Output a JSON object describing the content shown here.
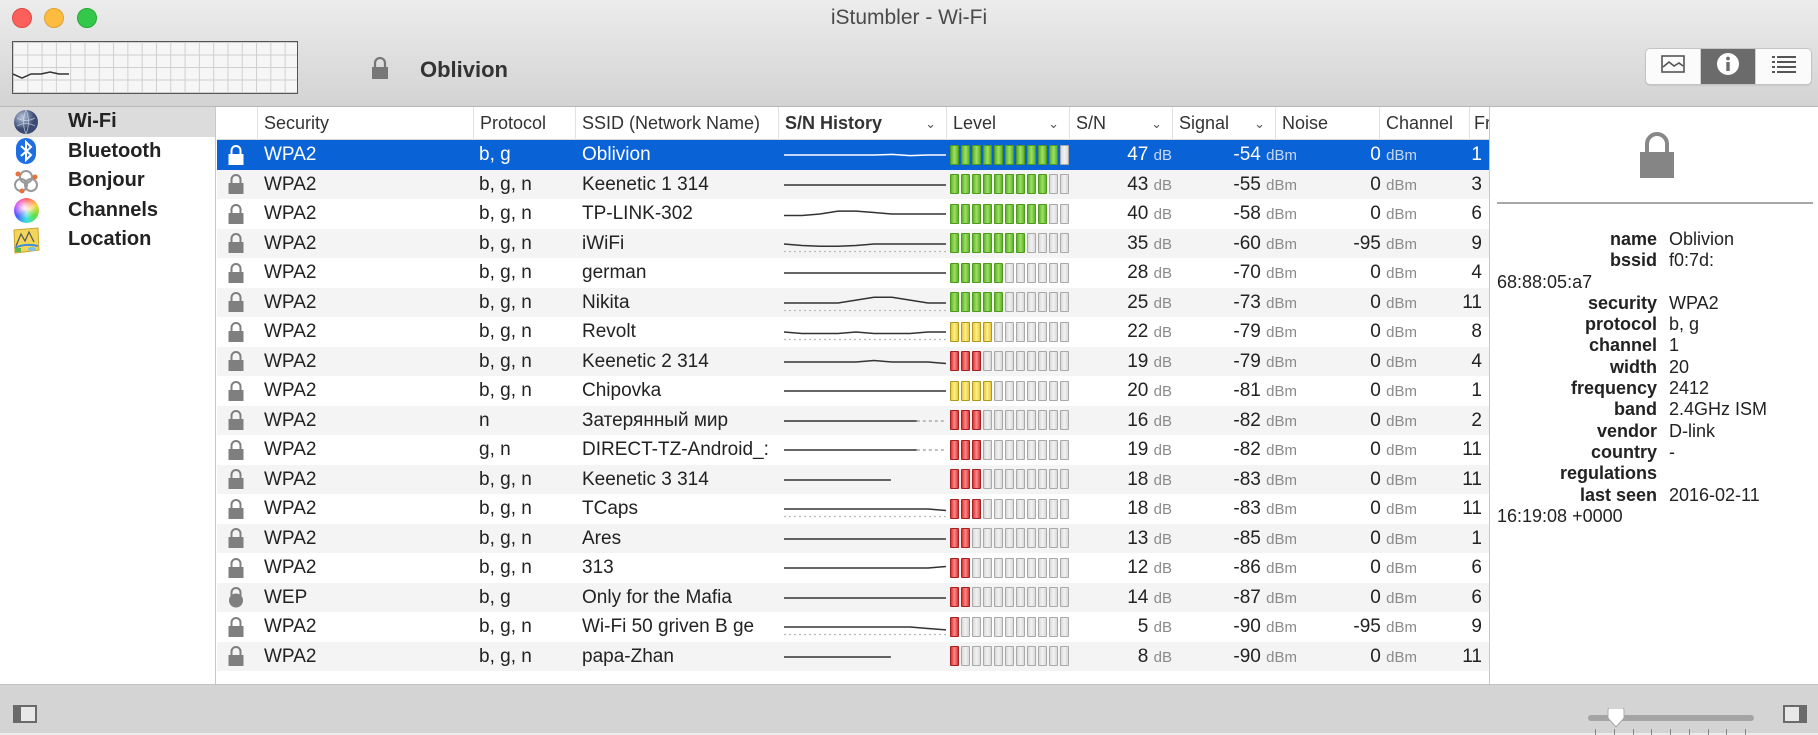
{
  "window": {
    "title": "iStumbler - Wi-Fi"
  },
  "header": {
    "selected_network": "Oblivion",
    "view_modes": [
      {
        "name": "graph-view",
        "icon": "chart-icon",
        "active": false
      },
      {
        "name": "info-view",
        "icon": "info-icon",
        "active": true
      },
      {
        "name": "list-view",
        "icon": "list-icon",
        "active": false
      }
    ]
  },
  "sidebar": {
    "items": [
      {
        "label": "Wi-Fi",
        "icon": "globe-icon",
        "selected": true
      },
      {
        "label": "Bluetooth",
        "icon": "bluetooth-icon",
        "selected": false
      },
      {
        "label": "Bonjour",
        "icon": "bonjour-icon",
        "selected": false
      },
      {
        "label": "Channels",
        "icon": "color-wheel-icon",
        "selected": false
      },
      {
        "label": "Location",
        "icon": "map-icon",
        "selected": false
      }
    ]
  },
  "table": {
    "columns": [
      {
        "key": "lock",
        "label": ""
      },
      {
        "key": "security",
        "label": "Security"
      },
      {
        "key": "protocol",
        "label": "Protocol"
      },
      {
        "key": "ssid",
        "label": "SSID (Network Name)"
      },
      {
        "key": "history",
        "label": "S/N History",
        "sortable": true
      },
      {
        "key": "level",
        "label": "Level",
        "sortable": true
      },
      {
        "key": "sn",
        "label": "S/N",
        "sortable": true
      },
      {
        "key": "signal",
        "label": "Signal",
        "sortable": true
      },
      {
        "key": "noise",
        "label": "Noise"
      },
      {
        "key": "channel",
        "label": "Channel"
      },
      {
        "key": "frequency",
        "label": "Fr"
      }
    ],
    "level_max_bars": 11,
    "units": {
      "sn": "dB",
      "signal": "dBm",
      "noise": "dBm"
    },
    "rows": [
      {
        "security": "WPA2",
        "protocol": "b, g",
        "ssid": "Oblivion",
        "level": 10,
        "level_color": "green",
        "sn": "47",
        "signal": "-54",
        "noise": "0",
        "channel": "1",
        "selected": true,
        "lock": "padlock",
        "history": [
          0.5,
          0.5,
          0.5,
          0.5,
          0.5,
          0.5,
          0.52,
          0.48,
          0.5,
          0.5
        ]
      },
      {
        "security": "WPA2",
        "protocol": "b, g, n",
        "ssid": "Keenetic  1 314",
        "level": 9,
        "level_color": "green",
        "sn": "43",
        "signal": "-55",
        "noise": "0",
        "channel": "3",
        "lock": "padlock",
        "history": [
          0.5,
          0.5,
          0.5,
          0.5,
          0.5,
          0.5,
          0.5,
          0.5,
          0.5,
          0.5
        ]
      },
      {
        "security": "WPA2",
        "protocol": "b, g, n",
        "ssid": "TP-LINK-302",
        "level": 9,
        "level_color": "green",
        "sn": "40",
        "signal": "-58",
        "noise": "0",
        "channel": "6",
        "lock": "padlock",
        "history": [
          0.45,
          0.45,
          0.5,
          0.6,
          0.6,
          0.55,
          0.5,
          0.5,
          0.5,
          0.5
        ]
      },
      {
        "security": "WPA2",
        "protocol": "b, g, n",
        "ssid": "iWiFi",
        "level": 7,
        "level_color": "green",
        "sn": "35",
        "signal": "-60",
        "noise": "-95",
        "channel": "9",
        "lock": "padlock",
        "history": [
          0.5,
          0.45,
          0.42,
          0.42,
          0.45,
          0.5,
          0.5,
          0.5,
          0.5,
          0.5
        ],
        "noise_history": true
      },
      {
        "security": "WPA2",
        "protocol": "b, g, n",
        "ssid": "german",
        "level": 5,
        "level_color": "green",
        "sn": "28",
        "signal": "-70",
        "noise": "0",
        "channel": "4",
        "lock": "padlock",
        "history": [
          0.5,
          0.5,
          0.5,
          0.5,
          0.5,
          0.5,
          0.5,
          0.5,
          0.5,
          0.5
        ]
      },
      {
        "security": "WPA2",
        "protocol": "b, g, n",
        "ssid": "Nikita",
        "level": 5,
        "level_color": "green",
        "sn": "25",
        "signal": "-73",
        "noise": "0",
        "channel": "11",
        "lock": "padlock",
        "history": [
          0.5,
          0.5,
          0.5,
          0.5,
          0.6,
          0.7,
          0.7,
          0.6,
          0.5,
          0.5
        ],
        "noise_history": true
      },
      {
        "security": "WPA2",
        "protocol": "b, g, n",
        "ssid": "Revolt",
        "level": 4,
        "level_color": "yellow",
        "sn": "22",
        "signal": "-79",
        "noise": "0",
        "channel": "8",
        "lock": "padlock",
        "history": [
          0.5,
          0.45,
          0.45,
          0.45,
          0.5,
          0.45,
          0.45,
          0.45,
          0.5,
          0.5
        ],
        "noise_history": true
      },
      {
        "security": "WPA2",
        "protocol": "b, g, n",
        "ssid": "Keenetic 2 314",
        "level": 3,
        "level_color": "red",
        "sn": "19",
        "signal": "-79",
        "noise": "0",
        "channel": "4",
        "lock": "padlock",
        "history": [
          0.5,
          0.5,
          0.5,
          0.5,
          0.5,
          0.55,
          0.5,
          0.5,
          0.5,
          0.45
        ]
      },
      {
        "security": "WPA2",
        "protocol": "b, g, n",
        "ssid": "Chipovka",
        "level": 4,
        "level_color": "yellow",
        "sn": "20",
        "signal": "-81",
        "noise": "0",
        "channel": "1",
        "lock": "padlock",
        "history": [
          0.5,
          0.5,
          0.5,
          0.5,
          0.5,
          0.5,
          0.5,
          0.5,
          0.5,
          0.5
        ]
      },
      {
        "security": "WPA2",
        "protocol": "n",
        "ssid": "Затерянный мир",
        "level": 3,
        "level_color": "red",
        "sn": "16",
        "signal": "-82",
        "noise": "0",
        "channel": "2",
        "lock": "padlock",
        "history": [
          0.5,
          0.5,
          0.5,
          0.5,
          0.5,
          0.5,
          0.5,
          0.5
        ],
        "history_gap": true
      },
      {
        "security": "WPA2",
        "protocol": "g, n",
        "ssid": "DIRECT-TZ-Android_:",
        "level": 3,
        "level_color": "red",
        "sn": "19",
        "signal": "-82",
        "noise": "0",
        "channel": "11",
        "lock": "padlock",
        "history": [
          0.5,
          0.5,
          0.5,
          0.5,
          0.5,
          0.5,
          0.5,
          0.5
        ],
        "history_gap": true
      },
      {
        "security": "WPA2",
        "protocol": "b, g, n",
        "ssid": "Keenetic 3 314",
        "level": 3,
        "level_color": "red",
        "sn": "18",
        "signal": "-83",
        "noise": "0",
        "channel": "11",
        "lock": "padlock",
        "history": [
          0.5,
          0.5,
          0.5,
          0.5,
          0.5,
          0.5,
          0.5
        ],
        "history_short": true
      },
      {
        "security": "WPA2",
        "protocol": "b, g, n",
        "ssid": "TCaps",
        "level": 3,
        "level_color": "red",
        "sn": "18",
        "signal": "-83",
        "noise": "0",
        "channel": "11",
        "lock": "padlock",
        "history": [
          0.5,
          0.5,
          0.5,
          0.5,
          0.5,
          0.5,
          0.5,
          0.5,
          0.5,
          0.45
        ],
        "noise_history": true
      },
      {
        "security": "WPA2",
        "protocol": "b, g, n",
        "ssid": "Ares",
        "level": 2,
        "level_color": "red",
        "sn": "13",
        "signal": "-85",
        "noise": "0",
        "channel": "1",
        "lock": "padlock",
        "history": [
          0.5,
          0.5,
          0.5,
          0.5,
          0.5,
          0.5,
          0.5,
          0.5,
          0.5,
          0.5
        ]
      },
      {
        "security": "WPA2",
        "protocol": "b, g, n",
        "ssid": "313",
        "level": 2,
        "level_color": "red",
        "sn": "12",
        "signal": "-86",
        "noise": "0",
        "channel": "6",
        "lock": "padlock",
        "history": [
          0.5,
          0.5,
          0.5,
          0.5,
          0.5,
          0.5,
          0.5,
          0.5,
          0.5,
          0.55
        ]
      },
      {
        "security": "WEP",
        "protocol": "b, g",
        "ssid": "Only for the Mafia",
        "level": 2,
        "level_color": "red",
        "sn": "14",
        "signal": "-87",
        "noise": "0",
        "channel": "6",
        "lock": "round-lock",
        "history": [
          0.5,
          0.5,
          0.5,
          0.5,
          0.5,
          0.5,
          0.5,
          0.5,
          0.5,
          0.5
        ]
      },
      {
        "security": "WPA2",
        "protocol": "b, g, n",
        "ssid": "Wi-Fi 50 griven B ge",
        "level": 1,
        "level_color": "red",
        "sn": "5",
        "signal": "-90",
        "noise": "-95",
        "channel": "9",
        "lock": "padlock",
        "history": [
          0.5,
          0.5,
          0.5,
          0.5,
          0.5,
          0.5,
          0.5,
          0.5,
          0.45,
          0.4
        ],
        "noise_history": true
      },
      {
        "security": "WPA2",
        "protocol": "b, g, n",
        "ssid": "papa-Zhan",
        "level": 1,
        "level_color": "red",
        "sn": "8",
        "signal": "-90",
        "noise": "0",
        "channel": "11",
        "lock": "padlock",
        "history": [
          0.5,
          0.5,
          0.5,
          0.5,
          0.5,
          0.5,
          0.5
        ],
        "history_short": true
      }
    ]
  },
  "detail": {
    "fields": [
      {
        "key": "name",
        "value": "Oblivion"
      },
      {
        "key": "bssid",
        "value": "f0:7d:",
        "continuation": "68:88:05:a7"
      },
      {
        "key": "security",
        "value": "WPA2"
      },
      {
        "key": "protocol",
        "value": "b, g"
      },
      {
        "key": "channel",
        "value": "1"
      },
      {
        "key": "width",
        "value": "20"
      },
      {
        "key": "frequency",
        "value": "2412"
      },
      {
        "key": "band",
        "value": "2.4GHz ISM"
      },
      {
        "key": "vendor",
        "value": "D-link"
      },
      {
        "key": "country",
        "value": "-"
      },
      {
        "key": "regulations",
        "value": ""
      },
      {
        "key": "last seen",
        "value": "2016-02-11",
        "continuation": "16:19:08 +0000"
      }
    ]
  },
  "footer": {
    "zoom_slider": {
      "value": 0.125,
      "tick_count": 9
    }
  },
  "colors": {
    "selection": "#0a63d6",
    "level_green": "#5fb42a",
    "level_yellow": "#e8c940",
    "level_red": "#d83434"
  }
}
